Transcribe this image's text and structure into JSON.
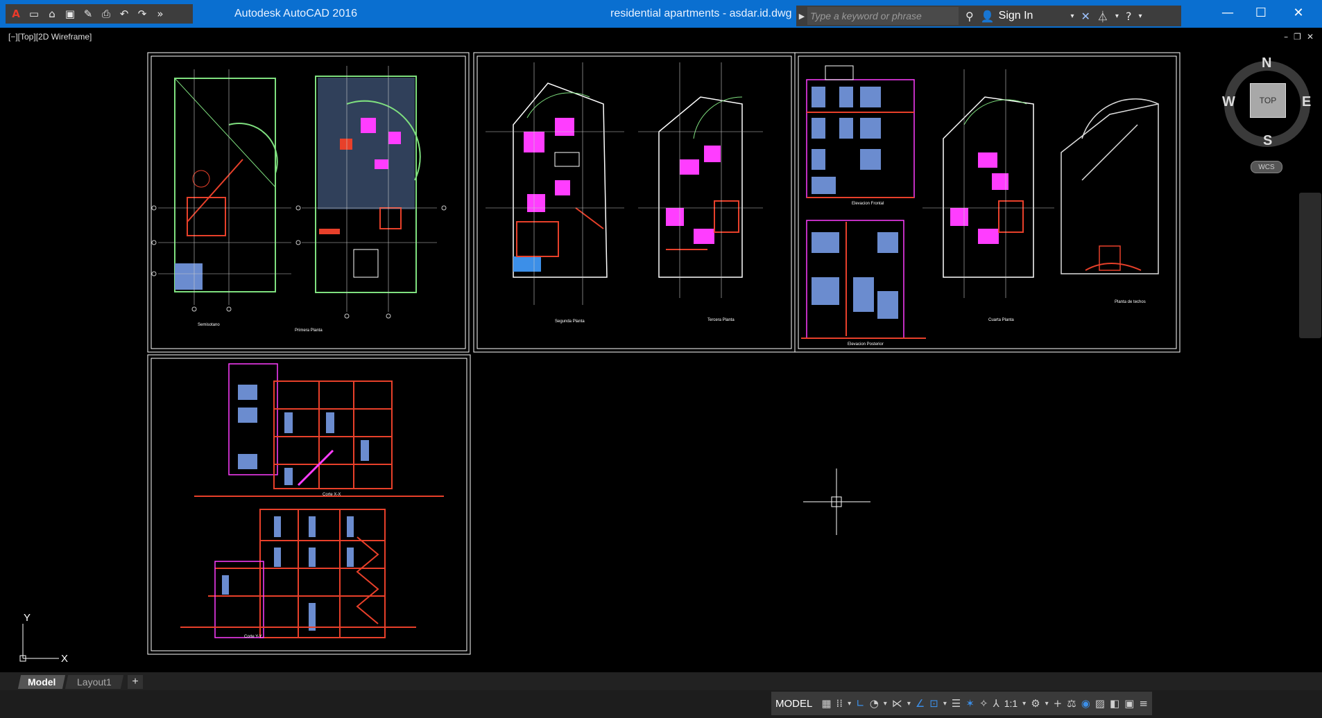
{
  "titlebar": {
    "app_title": "Autodesk AutoCAD 2016",
    "doc_title": "residential apartments - asdar.id.dwg",
    "search_placeholder": "Type a keyword or phrase",
    "signin_label": "Sign In",
    "quick_access_icons": [
      "autocad-logo-icon",
      "new-file-icon",
      "open-file-icon",
      "save-icon",
      "save-as-icon",
      "print-icon",
      "undo-icon",
      "redo-icon",
      "more-icon"
    ],
    "window_controls": [
      "minimize-icon",
      "maximize-icon",
      "close-icon"
    ]
  },
  "viewport": {
    "label": "[−][Top][2D Wireframe]",
    "controls": [
      "–",
      "❐",
      "✕"
    ]
  },
  "viewcube": {
    "north": "N",
    "south": "S",
    "east": "E",
    "west": "W",
    "top_face": "TOP",
    "wcs": "WCS"
  },
  "ucs": {
    "x_label": "X",
    "y_label": "Y"
  },
  "drawing_labels": {
    "sheet1_left": "Semisotano",
    "sheet1_right": "Primera Planta",
    "sheet2_left": "Segunda Planta",
    "sheet2_right": "Tercera Planta",
    "sheet3_elev_front": "Elevacion Frontal",
    "sheet3_elev_rear": "Elevacion Posterior",
    "sheet3_plan": "Cuarta Planta",
    "sheet3_roof": "Planta de techos",
    "sheet4_section1": "Corte X-X",
    "sheet4_section2": "Corte Y-Y"
  },
  "layout_tabs": {
    "model": "Model",
    "layout1": "Layout1",
    "add": "+"
  },
  "statusbar": {
    "model_label": "MODEL",
    "scale": "1:1"
  },
  "colors": {
    "titlebar": "#0a6fd0",
    "sheet_border": "#ffffff",
    "red_lines": "#e8402a",
    "magenta_fill": "#ff3dff",
    "green_lines": "#7fe07f",
    "blue_fill": "#6b8ccf"
  }
}
